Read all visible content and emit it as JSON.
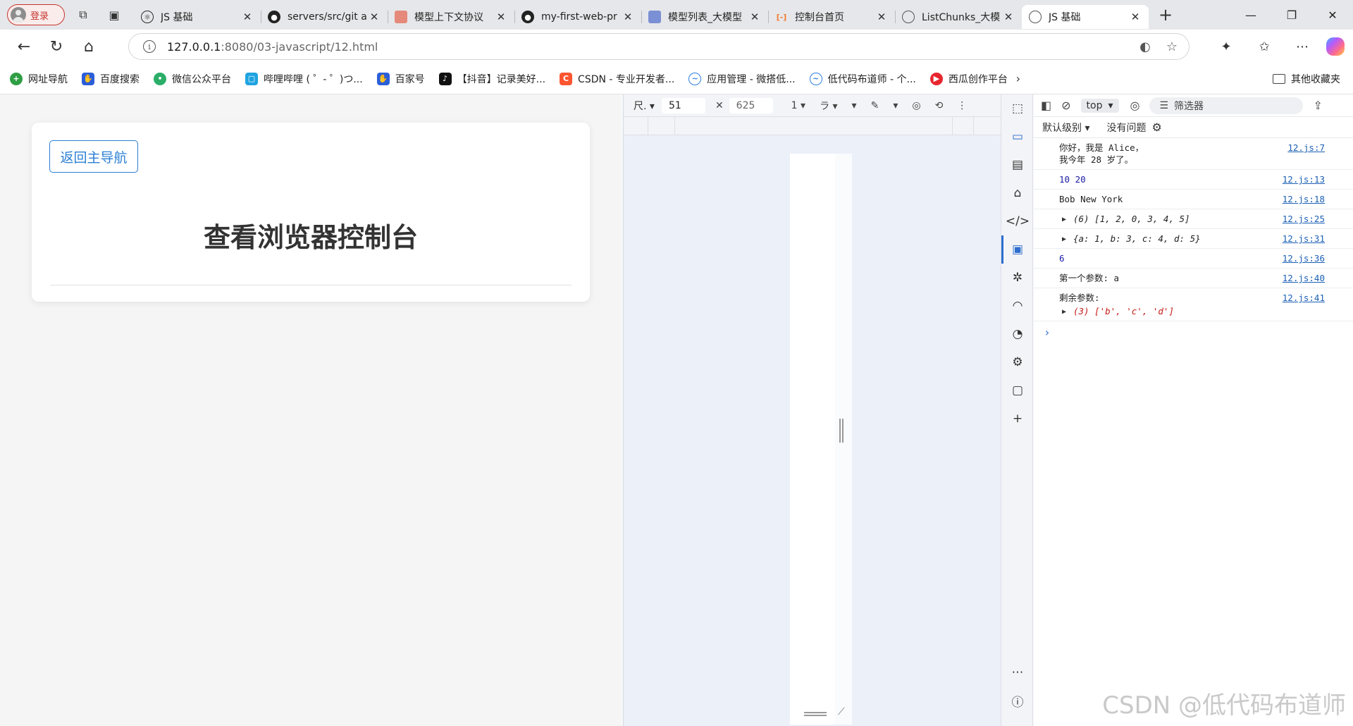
{
  "browser": {
    "profile_label": "登录",
    "tabs": [
      {
        "label": "JS 基础",
        "icon": "react-icon",
        "icon_color": "#2b2b2b"
      },
      {
        "label": "servers/src/git a",
        "icon": "github-icon",
        "icon_color": "#222222"
      },
      {
        "label": "模型上下文协议",
        "icon": "mcp-icon",
        "icon_color": "#e58a7a"
      },
      {
        "label": "my-first-web-pr",
        "icon": "github-icon",
        "icon_color": "#222222"
      },
      {
        "label": "模型列表_大模型",
        "icon": "doc-icon",
        "icon_color": "#7b8fd4"
      },
      {
        "label": "控制台首页",
        "icon": "aliyun-icon",
        "icon_color": "#f07c33"
      },
      {
        "label": "ListChunks_大模",
        "icon": "globe-icon",
        "icon_color": "#555555"
      },
      {
        "label": "JS 基础",
        "icon": "globe-icon",
        "icon_color": "#555555",
        "active": true
      }
    ],
    "url_host": "127.0.0.1",
    "url_path": ":8080/03-javascript/12.html"
  },
  "bookmarks": {
    "items": [
      {
        "label": "网址导航",
        "icon": "hao-icon",
        "color": "#2f9e44"
      },
      {
        "label": "百度搜索",
        "icon": "baidu-icon",
        "color": "#2b5fd9"
      },
      {
        "label": "微信公众平台",
        "icon": "wechat-icon",
        "color": "#2aae67"
      },
      {
        "label": "哔哩哔哩 ( ゜- ゜)つ...",
        "icon": "bilibili-icon",
        "color": "#1fa3e0"
      },
      {
        "label": "百家号",
        "icon": "baijiahao-icon",
        "color": "#2b5fd9"
      },
      {
        "label": "【抖音】记录美好...",
        "icon": "douyin-icon",
        "color": "#111111"
      },
      {
        "label": "CSDN - 专业开发者...",
        "icon": "csdn-icon",
        "color": "#fc5531"
      },
      {
        "label": "应用管理 - 微搭低...",
        "icon": "cloud-icon",
        "color": "#2f7fe0"
      },
      {
        "label": "低代码布道师 - 个...",
        "icon": "cloud-icon",
        "color": "#2f7fe0"
      },
      {
        "label": "西瓜创作平台",
        "icon": "xigua-icon",
        "color": "#e8262e"
      }
    ],
    "other_label": "其他收藏夹"
  },
  "page": {
    "back_button": "返回主导航",
    "title": "查看浏览器控制台"
  },
  "device_toolbar": {
    "width": "51",
    "height": "625"
  },
  "console": {
    "context": "top",
    "filter_placeholder": "筛选器",
    "level_label": "默认级别",
    "issues_label": "没有问题",
    "messages": [
      {
        "text1": "你好，我是 Alice，",
        "text2": "我今年 28 岁了。",
        "source": "12.js:7"
      },
      {
        "text": "10 20",
        "source": "12.js:13"
      },
      {
        "text": "Bob New York",
        "source": "12.js:18"
      },
      {
        "text": "(6) [1, 2, 0, 3, 4, 5]",
        "source": "12.js:25"
      },
      {
        "text": "{a: 1, b: 3, c: 4, d: 5}",
        "source": "12.js:31"
      },
      {
        "text": "6",
        "source": "12.js:36"
      },
      {
        "text": "第一个参数: a",
        "source": "12.js:40"
      },
      {
        "text1": "剩余参数:",
        "text2": "(3) ['b', 'c', 'd']",
        "source": "12.js:41"
      }
    ]
  },
  "watermark": "CSDN @低代码布道师"
}
